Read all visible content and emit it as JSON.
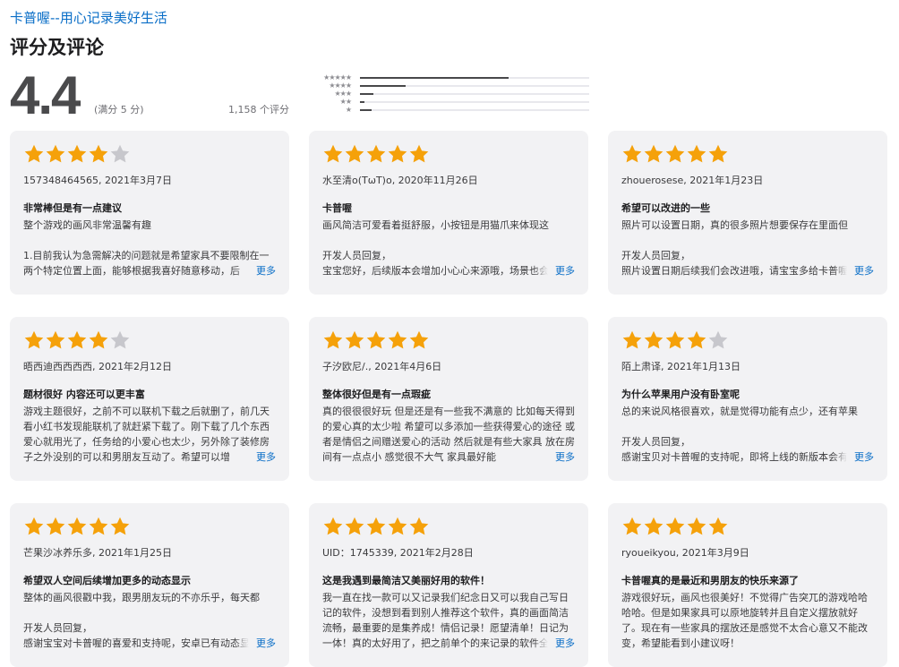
{
  "header": {
    "app_link": "卡普喔--用心记录美好生活",
    "section_title": "评分及评论"
  },
  "summary": {
    "rating": "4.4",
    "out_of": "(满分 5 分)",
    "count": "1,158 个评分",
    "histogram": [
      {
        "stars": 5,
        "fraction": 0.65
      },
      {
        "stars": 4,
        "fraction": 0.2
      },
      {
        "stars": 3,
        "fraction": 0.06
      },
      {
        "stars": 2,
        "fraction": 0.02
      },
      {
        "stars": 1,
        "fraction": 0.05
      }
    ]
  },
  "more_label": "更多",
  "colors": {
    "star": "#f5a10a",
    "star_empty": "#c7c7cc",
    "link": "#0a6ec7"
  },
  "reviews": [
    {
      "stars": 4,
      "meta": "157348464565, 2021年3月7日",
      "title": "非常棒但是有一点建议",
      "body": "整个游戏的画风非常温馨有趣\n\n1.目前我认为急需解决的问题就是希望家具不要限制在一两个特定位置上面，能够根据我喜好随意移动，后"
    },
    {
      "stars": 5,
      "meta": "水至清o(TωT)o, 2020年11月26日",
      "title": "卡普喔",
      "body": "画风简洁可爱看着挺舒服，小按钮是用猫爪来体现这\n\n开发人员回复，\n宝宝您好，后续版本会增加小心心来源哦，场景也会"
    },
    {
      "stars": 5,
      "meta": "zhouerosese, 2021年1月23日",
      "title": "希望可以改进的一些",
      "body": "照片可以设置日期，真的很多照片想要保存在里面但\n\n开发人员回复，\n照片设置日期后续我们会改进哦，请宝宝多给卡普喔"
    },
    {
      "stars": 4,
      "meta": "晤西迪西西西西, 2021年2月12日",
      "title": "题材很好 内容还可以更丰富",
      "body": "游戏主题很好，之前不可以联机下载之后就删了，前几天看小红书发现能联机了就赶紧下载了。刚下载了几个东西爱心就用光了，任务给的小爱心也太少，另外除了装修房子之外没别的可以和男朋友互动了。希望可以增"
    },
    {
      "stars": 5,
      "meta": "子汐欧尼/., 2021年4月6日",
      "title": "整体很好但是有一点瑕疵",
      "body": "真的很很很好玩 但是还是有一些我不满意的 比如每天得到的爱心真的太少啦 希望可以多添加一些获得爱心的途径 或者是情侣之间赠送爱心的活动 然后就是有些大家具 放在房间有一点点小 感觉很不大气 家具最好能"
    },
    {
      "stars": 4,
      "meta": "陌上肃译, 2021年1月13日",
      "title": "为什么苹果用户没有卧室呢",
      "body": "总的来说风格很喜欢，就是觉得功能有点少，还有苹果\n\n开发人员回复，\n感谢宝贝对卡普喔的支持呢，即将上线的新版本会有"
    },
    {
      "stars": 5,
      "meta": "芒果沙冰养乐多, 2021年1月25日",
      "title": "希望双人空间后续增加更多的动态显示",
      "body": "整体的画风很戳中我，跟男朋友玩的不亦乐乎，每天都\n\n开发人员回复，\n感谢宝宝对卡普喔的喜爱和支持呢，安卓已有动态显"
    },
    {
      "stars": 5,
      "meta": "UID：1745339, 2021年2月28日",
      "title": "这是我遇到最简洁又美丽好用的软件！",
      "body": "我一直在找一款可以又记录我们纪念日又可以我自己写日记的软件，没想到看到别人推荐这个软件，真的画面简洁流畅，最重要的是集养成！情侣记录！愿望清单！日记为一体！真的太好用了，把之前单个的来记录的软件全部"
    },
    {
      "stars": 5,
      "meta": "ryoueikyou, 2021年3月9日",
      "title": "卡普喔真的是最近和男朋友的快乐来源了",
      "body": "游戏很好玩，画风也很美好！不觉得广告突兀的游戏哈哈哈哈。但是如果家具可以原地旋转并且自定义摆放就好了。现在有一些家具的摆放还是感觉不太合心意又不能改变，希望能看到小建议呀！",
      "no_more": true
    }
  ]
}
